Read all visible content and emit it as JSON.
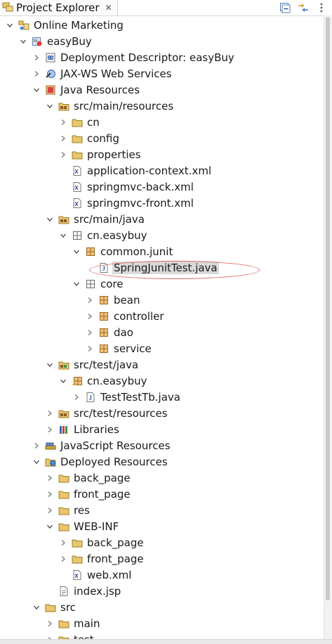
{
  "view": {
    "title": "Project Explorer",
    "close_glyph": "✕",
    "actions": [
      "collapse-all-icon",
      "link-with-editor-icon",
      "view-menu-icon"
    ]
  },
  "colors": {
    "selection": "#d9d9d9",
    "annotation_ellipse": "#e06060",
    "folder": "#e8c66a",
    "package": "#b07a3a"
  },
  "tree": [
    {
      "label": "Online Marketing",
      "icon": "working-set",
      "depth": 0,
      "twisty": "expanded"
    },
    {
      "label": "easyBuy",
      "icon": "web-project",
      "depth": 1,
      "twisty": "expanded"
    },
    {
      "label": "Deployment Descriptor: easyBuy",
      "icon": "deployment-descriptor",
      "depth": 2,
      "twisty": "collapsed"
    },
    {
      "label": "JAX-WS Web Services",
      "icon": "web-services",
      "depth": 2,
      "twisty": "collapsed"
    },
    {
      "label": "Java Resources",
      "icon": "java-resources",
      "depth": 2,
      "twisty": "expanded"
    },
    {
      "label": "src/main/resources",
      "icon": "source-folder",
      "depth": 3,
      "twisty": "expanded"
    },
    {
      "label": "cn",
      "icon": "folder",
      "depth": 4,
      "twisty": "collapsed"
    },
    {
      "label": "config",
      "icon": "folder",
      "depth": 4,
      "twisty": "collapsed"
    },
    {
      "label": "properties",
      "icon": "folder",
      "depth": 4,
      "twisty": "collapsed"
    },
    {
      "label": "application-context.xml",
      "icon": "xml-file",
      "depth": 4,
      "twisty": "none"
    },
    {
      "label": "springmvc-back.xml",
      "icon": "xml-file",
      "depth": 4,
      "twisty": "none"
    },
    {
      "label": "springmvc-front.xml",
      "icon": "xml-file",
      "depth": 4,
      "twisty": "none"
    },
    {
      "label": "src/main/java",
      "icon": "source-folder",
      "depth": 3,
      "twisty": "expanded"
    },
    {
      "label": "cn.easybuy",
      "icon": "package-empty",
      "depth": 4,
      "twisty": "expanded"
    },
    {
      "label": "common.junit",
      "icon": "package",
      "depth": 5,
      "twisty": "expanded"
    },
    {
      "label": "SpringJunitTest.java",
      "icon": "java-file",
      "depth": 6,
      "twisty": "none",
      "selected": true
    },
    {
      "label": "core",
      "icon": "package-empty",
      "depth": 5,
      "twisty": "expanded"
    },
    {
      "label": "bean",
      "icon": "package",
      "depth": 6,
      "twisty": "collapsed"
    },
    {
      "label": "controller",
      "icon": "package",
      "depth": 6,
      "twisty": "collapsed"
    },
    {
      "label": "dao",
      "icon": "package",
      "depth": 6,
      "twisty": "collapsed"
    },
    {
      "label": "service",
      "icon": "package",
      "depth": 6,
      "twisty": "collapsed"
    },
    {
      "label": "src/test/java",
      "icon": "source-folder-test",
      "depth": 3,
      "twisty": "expanded"
    },
    {
      "label": "cn.easybuy",
      "icon": "package-test",
      "depth": 4,
      "twisty": "expanded"
    },
    {
      "label": "TestTestTb.java",
      "icon": "java-file",
      "depth": 5,
      "twisty": "collapsed"
    },
    {
      "label": "src/test/resources",
      "icon": "source-folder",
      "depth": 3,
      "twisty": "collapsed"
    },
    {
      "label": "Libraries",
      "icon": "libraries",
      "depth": 3,
      "twisty": "collapsed"
    },
    {
      "label": "JavaScript Resources",
      "icon": "javascript-resources",
      "depth": 2,
      "twisty": "collapsed"
    },
    {
      "label": "Deployed Resources",
      "icon": "deployed-resources",
      "depth": 2,
      "twisty": "expanded"
    },
    {
      "label": "back_page",
      "icon": "folder",
      "depth": 3,
      "twisty": "collapsed"
    },
    {
      "label": "front_page",
      "icon": "folder",
      "depth": 3,
      "twisty": "collapsed"
    },
    {
      "label": "res",
      "icon": "folder",
      "depth": 3,
      "twisty": "collapsed"
    },
    {
      "label": "WEB-INF",
      "icon": "folder",
      "depth": 3,
      "twisty": "expanded"
    },
    {
      "label": "back_page",
      "icon": "folder",
      "depth": 4,
      "twisty": "collapsed"
    },
    {
      "label": "front_page",
      "icon": "folder",
      "depth": 4,
      "twisty": "collapsed"
    },
    {
      "label": "web.xml",
      "icon": "xml-file",
      "depth": 4,
      "twisty": "none"
    },
    {
      "label": "index.jsp",
      "icon": "jsp-file",
      "depth": 3,
      "twisty": "none"
    },
    {
      "label": "src",
      "icon": "folder",
      "depth": 2,
      "twisty": "expanded"
    },
    {
      "label": "main",
      "icon": "folder",
      "depth": 3,
      "twisty": "collapsed"
    },
    {
      "label": "test",
      "icon": "folder",
      "depth": 3,
      "twisty": "collapsed"
    }
  ]
}
